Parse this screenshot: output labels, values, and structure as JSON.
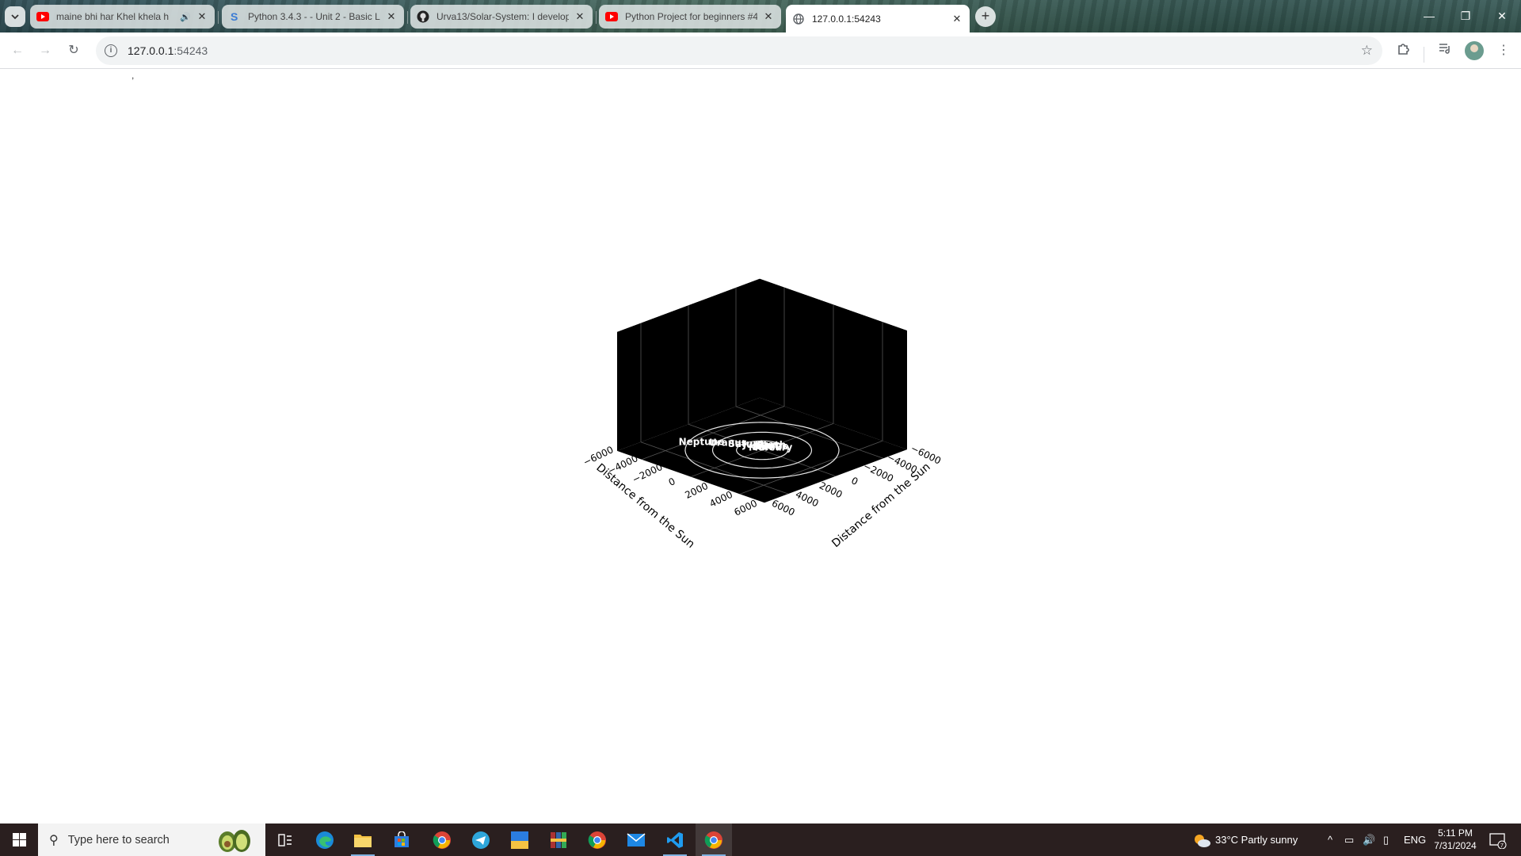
{
  "browser": {
    "tabs": [
      {
        "title": "maine bhi har Khel khela h",
        "favicon": "youtube-icon",
        "audio": true
      },
      {
        "title": "Python 3.4.3 - - Unit 2 - Basic L",
        "favicon": "s-logo-icon",
        "audio": false
      },
      {
        "title": "Urva13/Solar-System: I develop",
        "favicon": "github-icon",
        "audio": false
      },
      {
        "title": "Python Project for beginners #4",
        "favicon": "youtube-icon",
        "audio": false
      },
      {
        "title": "127.0.0.1:54243",
        "favicon": "globe-icon",
        "audio": false,
        "active": true
      }
    ],
    "address": {
      "host": "127.0.0.1",
      "port": ":54243"
    }
  },
  "page": {
    "stray_mark": ","
  },
  "chart_data": {
    "type": "scatter",
    "projection": "3d",
    "background": "#000000",
    "xlabel": "Distance from the Sun",
    "ylabel": "Distance from the Sun",
    "x_ticks": [
      "−6000",
      "−4000",
      "−2000",
      "0",
      "2000",
      "4000",
      "6000"
    ],
    "y_ticks": [
      "−6000",
      "−4000",
      "−2000",
      "0",
      "2000",
      "4000",
      "6000"
    ],
    "xlim": [
      -6000,
      6000
    ],
    "ylim": [
      -6000,
      6000
    ],
    "grid": true,
    "orbit_radii": [
      1500,
      2900,
      4500
    ],
    "planet_labels": [
      {
        "name": "Neptune",
        "x": -3100,
        "y": 1900
      },
      {
        "name": "Uranus",
        "x": -1900,
        "y": 900
      },
      {
        "name": "Saturn",
        "x": -1000,
        "y": 300
      },
      {
        "name": "Jupiter",
        "x": -300,
        "y": -200
      },
      {
        "name": "Mars",
        "x": 100,
        "y": -400
      },
      {
        "name": "Venus",
        "x": 300,
        "y": -500
      },
      {
        "name": "Mercury",
        "x": 400,
        "y": -300
      },
      {
        "name": "Earth",
        "x": 200,
        "y": -600
      },
      {
        "name": "Sun",
        "x": 0,
        "y": 0
      }
    ]
  },
  "taskbar": {
    "search_placeholder": "Type here to search",
    "weather": "33°C  Partly sunny",
    "lang": "ENG",
    "time": "5:11 PM",
    "date": "7/31/2024",
    "notification_count": "7"
  }
}
